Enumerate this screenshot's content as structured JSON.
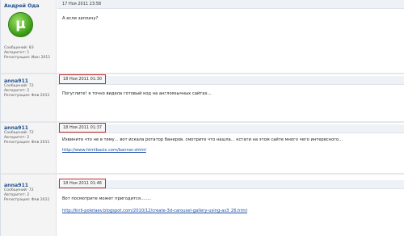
{
  "posts": [
    {
      "author": "Андрей Ода",
      "stats": [
        "Сообщений: 83",
        "Авторитет: 1",
        "Регистрация: Июн 2011"
      ],
      "date": "17 Ноя 2011 23:58",
      "message": "А если заплачу?",
      "link": ""
    },
    {
      "author": "anna911",
      "stats": [
        "Сообщений: 72",
        "Авторитет: 2",
        "Регистрация: Фев 2011"
      ],
      "date": "18 Ноя 2011 01:30",
      "message": "Погуглите! я точно видела готовый код на англоязычных сайтах...",
      "link": ""
    },
    {
      "author": "anna911",
      "stats": [
        "Сообщений: 72",
        "Авторитет: 2",
        "Регистрация: Фев 2011"
      ],
      "date": "18 Ноя 2011 01:37",
      "message": "Извините что не в тему... вот искала ротатор банеров. смотрите что нашла... кстати на этом сайте много чего интересного...",
      "link": "http://www.htmlbasix.com/banner.shtml"
    },
    {
      "author": "anna911",
      "stats": [
        "Сообщений: 72",
        "Авторитет: 2",
        "Регистрация: Фев 2011"
      ],
      "date": "18 Ноя 2011 01:46",
      "message": "Вот посмотрите может пригодится........",
      "link": "http://kiril-poletaev.blogspot.com/2010/12/create-3d-carousel-gallery-using-as3_26.html"
    }
  ],
  "colors": {
    "highlight_border": "#c0302d",
    "username": "#1f4e8c",
    "link": "#1a4fa8"
  },
  "icons": {
    "avatar": "utorrent-logo-icon"
  }
}
